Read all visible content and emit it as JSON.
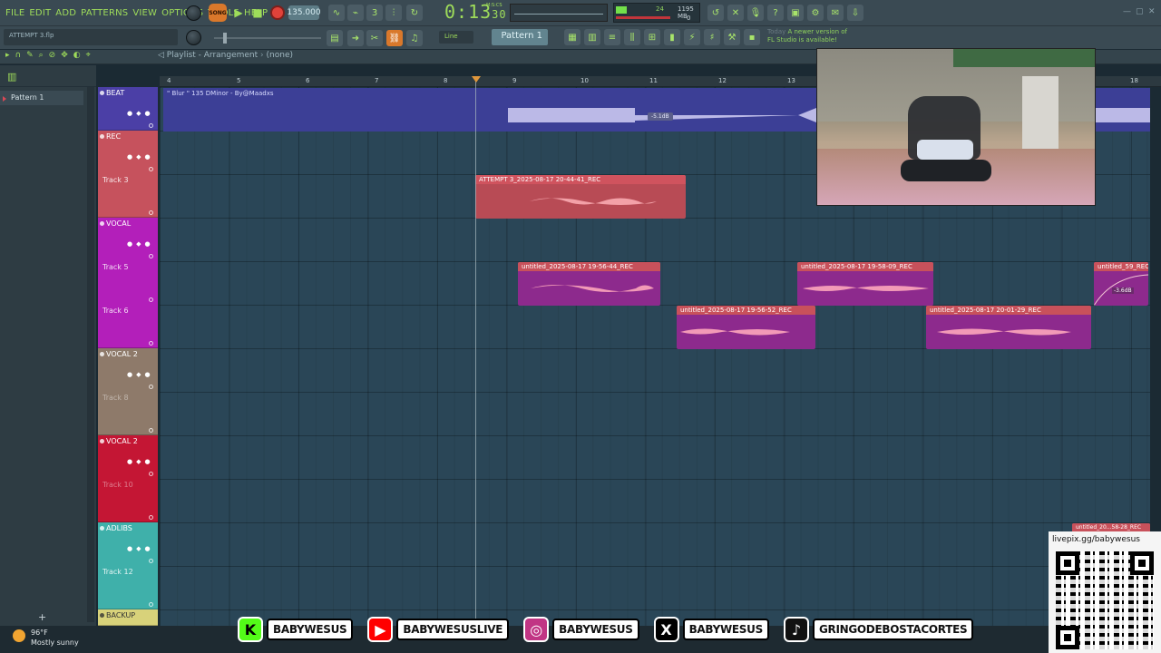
{
  "menu": [
    "FILE",
    "EDIT",
    "ADD",
    "PATTERNS",
    "VIEW",
    "OPTIONS",
    "TOOLS",
    "HELP"
  ],
  "transport": {
    "mode_label": "SONG",
    "tempo": "135.000",
    "time_main": "0:13",
    "time_small": "30",
    "time_unit": "M:S:CS"
  },
  "cpu": {
    "value": "24",
    "memory": "1195 MB",
    "voices": "0"
  },
  "hint_text": "ATTEMPT 3.flp",
  "snap_label": "Line",
  "pattern_selector": "Pattern 1",
  "news": {
    "day": "Today",
    "message": "A newer version of FL Studio is available!"
  },
  "playlist": {
    "title": "Playlist - Arrangement",
    "separator": "›",
    "selection": "(none)"
  },
  "browser": {
    "items": [
      "Pattern 1"
    ]
  },
  "ruler": [
    {
      "label": "4"
    },
    {
      "label": "5"
    },
    {
      "label": "6"
    },
    {
      "label": "7"
    },
    {
      "label": "8"
    },
    {
      "label": "9"
    },
    {
      "label": "10"
    },
    {
      "label": "11"
    },
    {
      "label": "12"
    },
    {
      "label": "13"
    },
    {
      "label": "18"
    }
  ],
  "tracks": [
    {
      "name": "BEAT",
      "color": "#4b3fa6"
    },
    {
      "name": "REC",
      "sub": "Track 3",
      "color": "#c6525d"
    },
    {
      "name": "VOCAL",
      "sub1": "Track 5",
      "sub2": "Track 6",
      "color": "#b31fba"
    },
    {
      "name": "VOCAL 2",
      "sub": "Track 8",
      "color": "#8e7a6a"
    },
    {
      "name": "VOCAL 2",
      "sub": "Track 10",
      "color": "#c41634"
    },
    {
      "name": "ADLIBS",
      "sub": "Track 12",
      "color": "#3fb0aa"
    },
    {
      "name": "BACKUP",
      "color": "#d8d27a"
    }
  ],
  "clips": {
    "beat": {
      "name": "\" Blur \" 135 DMinor - By@Maadxs",
      "volume": "-5.1dB"
    },
    "attempt": {
      "name": "ATTEMPT 3_2025-08-17 20-44-41_REC"
    },
    "v1": {
      "name": "untitled_2025-08-17 19-56-44_REC"
    },
    "v2": {
      "name": "untitled_2025-08-17 19-58-09_REC"
    },
    "v3": {
      "name": "untitled_59_REC",
      "volume": "-3.6dB"
    },
    "v4": {
      "name": "untitled_2025-08-17 19-56-52_REC"
    },
    "v5": {
      "name": "untitled_2025-08-17 20-01-29_REC"
    },
    "v6": {
      "name": "untitled_20...58-28_REC"
    }
  },
  "qr": {
    "text": "livepix.gg/babywesus"
  },
  "socials": [
    {
      "icon": "kick-icon",
      "glyph": "K",
      "label": "BABYWESUS",
      "color": "#53fc18"
    },
    {
      "icon": "youtube-icon",
      "glyph": "▶",
      "label": "BABYWESUSLIVE",
      "color": "#ff0000"
    },
    {
      "icon": "instagram-icon",
      "glyph": "◎",
      "label": "BABYWESUS",
      "color": "#c13584"
    },
    {
      "icon": "x-icon",
      "glyph": "X",
      "label": "BABYWESUS",
      "color": "#000000"
    },
    {
      "icon": "tiktok-icon",
      "glyph": "♪",
      "label": "GRINGODEBOSTACORTES",
      "color": "#111111"
    }
  ],
  "weather": {
    "temp": "96°F",
    "condition": "Mostly sunny"
  }
}
